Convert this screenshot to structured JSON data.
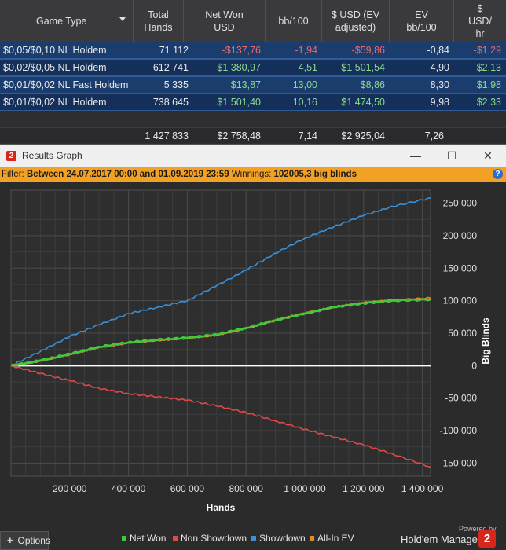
{
  "table": {
    "columns": [
      "Game Type",
      "Total\nHands",
      "Net Won\nUSD",
      "bb/100",
      "$ USD (EV\nadjusted)",
      "EV\nbb/100",
      "$\nUSD/\nhr"
    ],
    "rows": [
      {
        "game": "$0,05/$0,10 NL Holdem",
        "hands": "71 112",
        "net_won": "-$137,76",
        "bb100": "-1,94",
        "ev_usd": "-$59,86",
        "ev_bb100": "-0,84",
        "usd_hr": "-$1,29"
      },
      {
        "game": "$0,02/$0,05 NL Holdem",
        "hands": "612 741",
        "net_won": "$1 380,97",
        "bb100": "4,51",
        "ev_usd": "$1 501,54",
        "ev_bb100": "4,90",
        "usd_hr": "$2,13"
      },
      {
        "game": "$0,01/$0,02 NL Fast Holdem",
        "hands": "5 335",
        "net_won": "$13,87",
        "bb100": "13,00",
        "ev_usd": "$8,86",
        "ev_bb100": "8,30",
        "usd_hr": "$1,98"
      },
      {
        "game": "$0,01/$0,02 NL Holdem",
        "hands": "738 645",
        "net_won": "$1 501,40",
        "bb100": "10,16",
        "ev_usd": "$1 474,50",
        "ev_bb100": "9,98",
        "usd_hr": "$2,33"
      }
    ],
    "totals": {
      "hands": "1 427 833",
      "net_won": "$2 758,48",
      "bb100": "7,14",
      "ev_usd": "$2 925,04",
      "ev_bb100": "7,26"
    }
  },
  "window": {
    "title": "Results Graph",
    "logo_text": "2",
    "minimize": "—",
    "maximize": "☐",
    "close": "✕"
  },
  "filter": {
    "label": "Filter:",
    "range": "Between 24.07.2017 00:00 and 01.09.2019 23:59",
    "winnings_label": "Winnings:",
    "winnings_value": "102005,3 big blinds",
    "help": "?"
  },
  "footer": {
    "options_label": "Options",
    "powered_by": "Powered by",
    "brand": "Hold'em Manager",
    "brand_logo": "2"
  },
  "colors": {
    "net_won": "#3ec93e",
    "non_showdown": "#e04848",
    "showdown": "#3a8fd6",
    "allin_ev": "#e08a2e",
    "grid": "#4a4a4a",
    "zero_line": "#ffffff"
  },
  "chart_data": {
    "type": "line",
    "xlabel": "Hands",
    "ylabel": "Big Blinds",
    "xlim": [
      0,
      1427833
    ],
    "ylim": [
      -170000,
      270000
    ],
    "x_ticks": [
      200000,
      400000,
      600000,
      800000,
      1000000,
      1200000,
      1400000
    ],
    "x_tick_labels": [
      "200 000",
      "400 000",
      "600 000",
      "800 000",
      "1 000 000",
      "1 200 000",
      "1 400 000"
    ],
    "y_ticks": [
      250000,
      200000,
      150000,
      100000,
      50000,
      0,
      -50000,
      -100000,
      -150000
    ],
    "y_tick_labels": [
      "250 000",
      "200 000",
      "150 000",
      "100 000",
      "50 000",
      "0",
      "-50 000",
      "-100 000",
      "-150 000"
    ],
    "grid": true,
    "legend_position": "bottom",
    "x": [
      0,
      100000,
      200000,
      300000,
      400000,
      500000,
      600000,
      700000,
      800000,
      900000,
      1000000,
      1100000,
      1200000,
      1300000,
      1427833
    ],
    "series": [
      {
        "name": "Net Won",
        "values": [
          0,
          8000,
          18000,
          29000,
          36000,
          40000,
          43000,
          48000,
          58000,
          70000,
          80000,
          90000,
          96000,
          100000,
          102005
        ]
      },
      {
        "name": "Non Showdown",
        "values": [
          0,
          -12000,
          -23000,
          -35000,
          -43000,
          -48000,
          -53000,
          -62000,
          -72000,
          -85000,
          -98000,
          -110000,
          -122000,
          -136000,
          -156000
        ]
      },
      {
        "name": "Showdown",
        "values": [
          0,
          22000,
          45000,
          63000,
          80000,
          90000,
          100000,
          123000,
          147000,
          173000,
          196000,
          214000,
          231000,
          245000,
          258000
        ]
      },
      {
        "name": "All-In EV",
        "values": [
          0,
          7000,
          17000,
          28000,
          35000,
          39000,
          42000,
          47000,
          57000,
          70000,
          81000,
          90000,
          97000,
          101000,
          104000
        ]
      }
    ]
  }
}
